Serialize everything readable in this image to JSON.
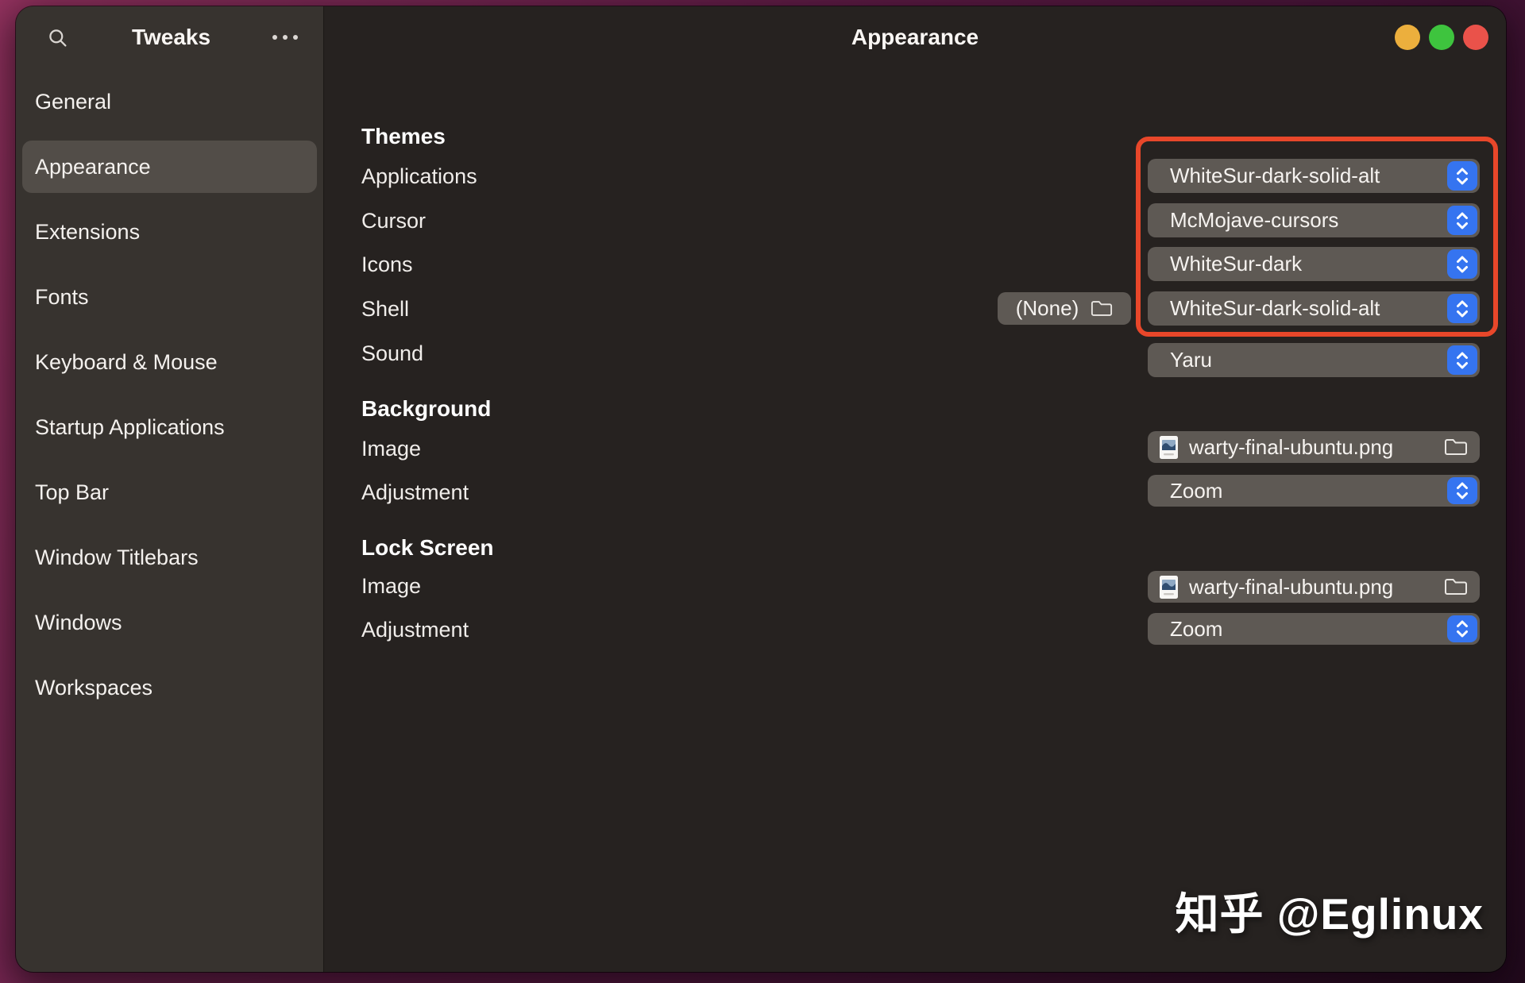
{
  "sidebar": {
    "title": "Tweaks",
    "items": [
      {
        "label": "General",
        "selected": false
      },
      {
        "label": "Appearance",
        "selected": true
      },
      {
        "label": "Extensions",
        "selected": false
      },
      {
        "label": "Fonts",
        "selected": false
      },
      {
        "label": "Keyboard & Mouse",
        "selected": false
      },
      {
        "label": "Startup Applications",
        "selected": false
      },
      {
        "label": "Top Bar",
        "selected": false
      },
      {
        "label": "Window Titlebars",
        "selected": false
      },
      {
        "label": "Windows",
        "selected": false
      },
      {
        "label": "Workspaces",
        "selected": false
      }
    ]
  },
  "header": {
    "title": "Appearance"
  },
  "window_controls": {
    "minimize_color": "#ecaf3d",
    "maximize_color": "#3ec43e",
    "close_color": "#ea524a"
  },
  "themes": {
    "title": "Themes",
    "rows": [
      {
        "label": "Applications",
        "value": "WhiteSur-dark-solid-alt"
      },
      {
        "label": "Cursor",
        "value": "McMojave-cursors"
      },
      {
        "label": "Icons",
        "value": "WhiteSur-dark"
      },
      {
        "label": "Shell",
        "value": "WhiteSur-dark-solid-alt",
        "file_value": "(None)"
      },
      {
        "label": "Sound",
        "value": "Yaru"
      }
    ]
  },
  "background": {
    "title": "Background",
    "image_label": "Image",
    "image_value": "warty-final-ubuntu.png",
    "adjustment_label": "Adjustment",
    "adjustment_value": "Zoom"
  },
  "lock_screen": {
    "title": "Lock Screen",
    "image_label": "Image",
    "image_value": "warty-final-ubuntu.png",
    "adjustment_label": "Adjustment",
    "adjustment_value": "Zoom"
  },
  "annotation": {
    "color": "#e8472a"
  },
  "accent_color": "#3574f0",
  "watermark": {
    "text": "知乎 @Eglinux"
  }
}
